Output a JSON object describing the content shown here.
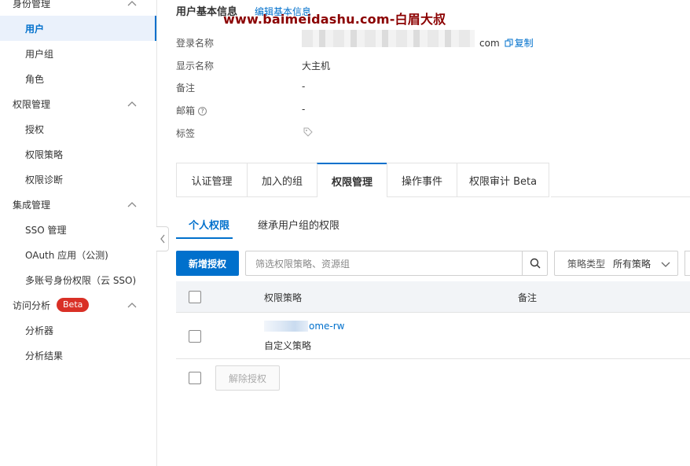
{
  "sidebar": {
    "groups": [
      {
        "label": "身份管理",
        "items": [
          "用户",
          "用户组",
          "角色"
        ]
      },
      {
        "label": "权限管理",
        "items": [
          "授权",
          "权限策略",
          "权限诊断"
        ]
      },
      {
        "label": "集成管理",
        "items": [
          "SSO 管理",
          "OAuth 应用（公测)",
          "多账号身份权限（云 SSO)"
        ]
      },
      {
        "label": "访问分析",
        "badge": "Beta",
        "items": [
          "分析器",
          "分析结果"
        ]
      }
    ],
    "active_item": "用户",
    "accent_color": "#0070cc",
    "badge_color": "#d93026"
  },
  "watermark": "www.baimeidashu.com-白眉大叔",
  "user_info": {
    "title": "用户基本信息",
    "edit_link": "编辑基本信息",
    "fields": [
      {
        "label": "登录名称",
        "value": "com",
        "action": "复制"
      },
      {
        "label": "显示名称",
        "value": "大主机"
      },
      {
        "label": "备注",
        "value": "-"
      },
      {
        "label": "邮箱",
        "value": "-",
        "help_icon": "help-circle-icon"
      },
      {
        "label": "标签",
        "value_icon": "tag-icon"
      }
    ]
  },
  "tabs": [
    "认证管理",
    "加入的组",
    "权限管理",
    "操作事件",
    "权限审计 Beta"
  ],
  "active_tab": "权限管理",
  "sub_tabs": [
    "个人权限",
    "继承用户组的权限"
  ],
  "active_sub_tab": "个人权限",
  "toolbar": {
    "add_button": "新增授权",
    "search_placeholder": "筛选权限策略、资源组",
    "select_label": "策略类型",
    "select_value": "所有策略"
  },
  "table": {
    "columns": [
      "权限策略",
      "备注"
    ],
    "rows": [
      {
        "policy_suffix": "ome-rw",
        "policy_type": "自定义策略",
        "note": ""
      }
    ]
  },
  "footer": {
    "remove_button": "解除授权"
  }
}
